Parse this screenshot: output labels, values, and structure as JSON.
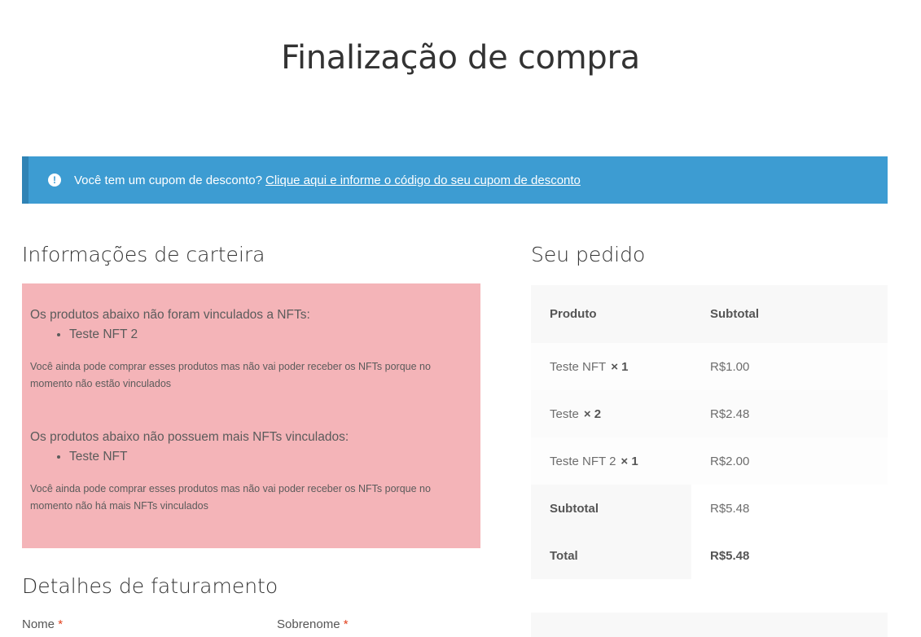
{
  "page": {
    "title": "Finalização de compra"
  },
  "notice": {
    "text": "Você tem um cupom de desconto?",
    "link": "Clique aqui e informe o código do seu cupom de desconto",
    "icon": "info-icon"
  },
  "wallet": {
    "heading": "Informações de carteira",
    "section1": {
      "lead": "Os produtos abaixo não foram vinculados a NFTs:",
      "items": [
        "Teste NFT 2"
      ],
      "note": "Você ainda pode comprar esses produtos mas não vai poder receber os NFTs porque no momento não estão vinculados"
    },
    "section2": {
      "lead": "Os produtos abaixo não possuem mais NFTs vinculados:",
      "items": [
        "Teste NFT"
      ],
      "note": "Você ainda pode comprar esses produtos mas não vai poder receber os NFTs porque no momento não há mais NFTs vinculados"
    }
  },
  "billing": {
    "heading": "Detalhes de faturamento",
    "first_name_label": "Nome",
    "last_name_label": "Sobrenome",
    "required_mark": "*"
  },
  "order": {
    "heading": "Seu pedido",
    "col_product": "Produto",
    "col_subtotal": "Subtotal",
    "items": [
      {
        "name": "Teste NFT",
        "qty": "× 1",
        "price": "R$1.00"
      },
      {
        "name": "Teste",
        "qty": "× 2",
        "price": "R$2.48"
      },
      {
        "name": "Teste NFT 2",
        "qty": "× 1",
        "price": "R$2.00"
      }
    ],
    "subtotal_label": "Subtotal",
    "subtotal_value": "R$5.48",
    "total_label": "Total",
    "total_value": "R$5.48"
  }
}
